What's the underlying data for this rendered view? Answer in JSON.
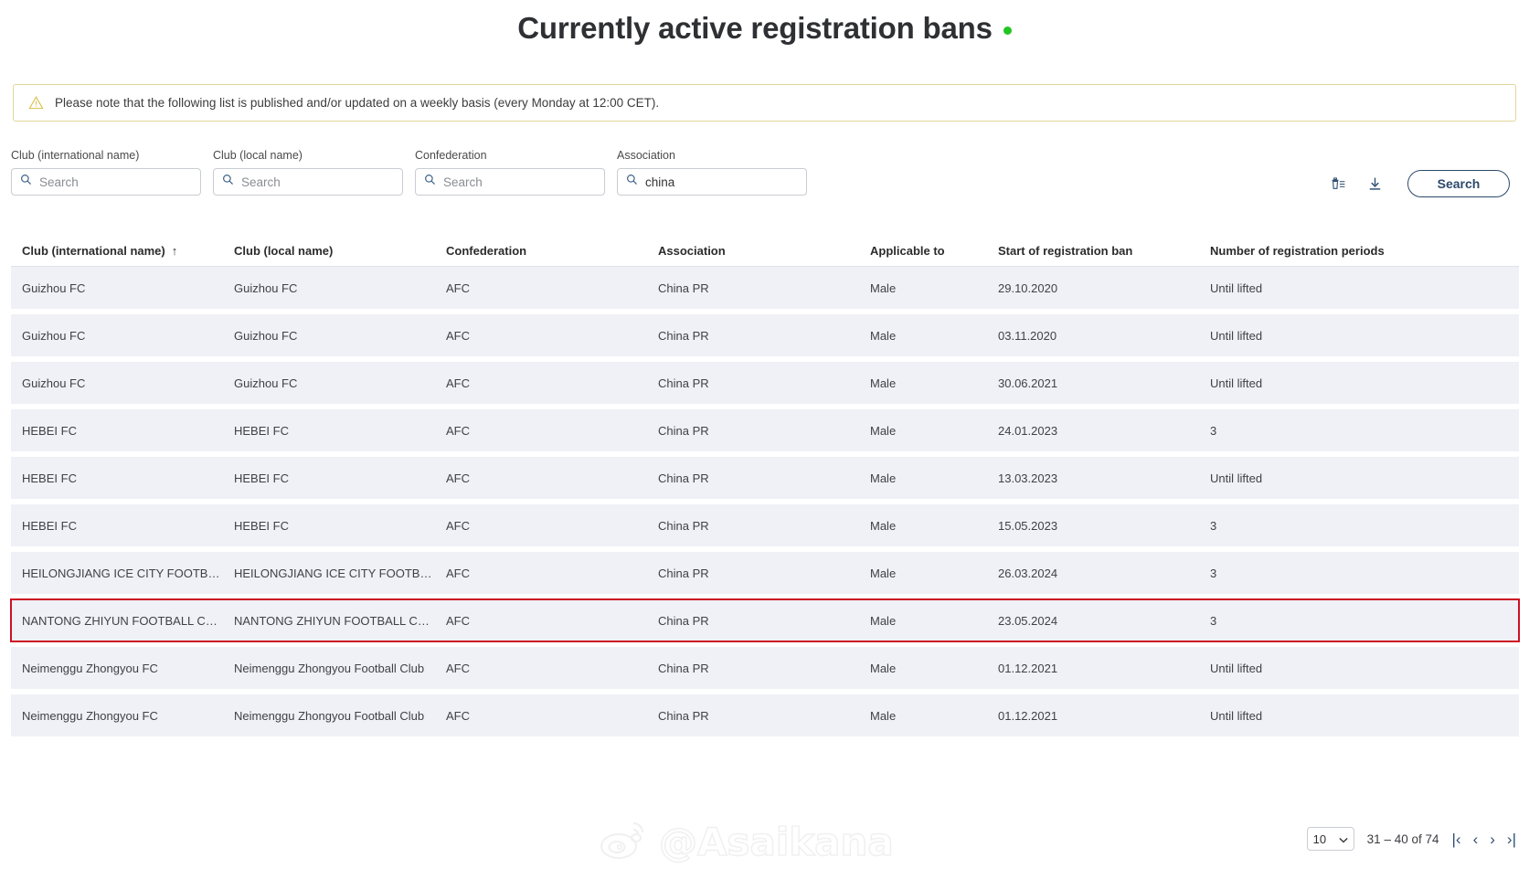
{
  "header": {
    "title": "Currently active registration bans",
    "status_dot_color": "#22c522"
  },
  "notice": {
    "icon": "warning-triangle-icon",
    "text": "Please note that the following list is published and/or updated on a weekly basis (every Monday at 12:00 CET)."
  },
  "filters": [
    {
      "label": "Club (international name)",
      "value": "",
      "placeholder": "Search"
    },
    {
      "label": "Club (local name)",
      "value": "",
      "placeholder": "Search"
    },
    {
      "label": "Confederation",
      "value": "",
      "placeholder": "Search"
    },
    {
      "label": "Association",
      "value": "china",
      "placeholder": "Search"
    }
  ],
  "toolbar": {
    "clear_filters_icon": "trash-list-icon",
    "download_icon": "download-icon",
    "search_label": "Search"
  },
  "table": {
    "columns": [
      "Club (international name)",
      "Club (local name)",
      "Confederation",
      "Association",
      "Applicable to",
      "Start of registration ban",
      "Number of registration periods"
    ],
    "sorted_column_index": 0,
    "sort_direction": "ascending",
    "sort_arrow": "↑",
    "rows": [
      {
        "cells": [
          "Guizhou FC",
          "Guizhou FC",
          "AFC",
          "China PR",
          "Male",
          "29.10.2020",
          "Until lifted"
        ],
        "highlighted": false
      },
      {
        "cells": [
          "Guizhou FC",
          "Guizhou FC",
          "AFC",
          "China PR",
          "Male",
          "03.11.2020",
          "Until lifted"
        ],
        "highlighted": false
      },
      {
        "cells": [
          "Guizhou FC",
          "Guizhou FC",
          "AFC",
          "China PR",
          "Male",
          "30.06.2021",
          "Until lifted"
        ],
        "highlighted": false
      },
      {
        "cells": [
          "HEBEI FC",
          "HEBEI FC",
          "AFC",
          "China PR",
          "Male",
          "24.01.2023",
          "3"
        ],
        "highlighted": false
      },
      {
        "cells": [
          "HEBEI FC",
          "HEBEI FC",
          "AFC",
          "China PR",
          "Male",
          "13.03.2023",
          "Until lifted"
        ],
        "highlighted": false
      },
      {
        "cells": [
          "HEBEI FC",
          "HEBEI FC",
          "AFC",
          "China PR",
          "Male",
          "15.05.2023",
          "3"
        ],
        "highlighted": false
      },
      {
        "cells": [
          "HEILONGJIANG ICE CITY FOOTBALL CL…",
          "HEILONGJIANG ICE CITY FOOTBALL CL…",
          "AFC",
          "China PR",
          "Male",
          "26.03.2024",
          "3"
        ],
        "highlighted": false
      },
      {
        "cells": [
          "NANTONG ZHIYUN FOOTBALL CLUB C…",
          "NANTONG ZHIYUN FOOTBALL CLUB C…",
          "AFC",
          "China PR",
          "Male",
          "23.05.2024",
          "3"
        ],
        "highlighted": true
      },
      {
        "cells": [
          "Neimenggu Zhongyou FC",
          "Neimenggu Zhongyou Football Club",
          "AFC",
          "China PR",
          "Male",
          "01.12.2021",
          "Until lifted"
        ],
        "highlighted": false
      },
      {
        "cells": [
          "Neimenggu Zhongyou FC",
          "Neimenggu Zhongyou Football Club",
          "AFC",
          "China PR",
          "Male",
          "01.12.2021",
          "Until lifted"
        ],
        "highlighted": false
      }
    ]
  },
  "pagination": {
    "page_size": "10",
    "range_text": "31 – 40 of 74",
    "first_icon": "first-page-icon",
    "prev_icon": "previous-page-icon",
    "next_icon": "next-page-icon",
    "last_icon": "last-page-icon",
    "first_glyph": "|‹",
    "prev_glyph": "‹",
    "next_glyph": "›",
    "last_glyph": "›|"
  },
  "watermark": {
    "icon": "weibo-icon",
    "text": "@Asaikana"
  },
  "colors": {
    "row_background": "#eff1f6",
    "highlight_border": "#cc1122",
    "accent": "#2d4a6b",
    "notice_border": "#e3d79a"
  }
}
